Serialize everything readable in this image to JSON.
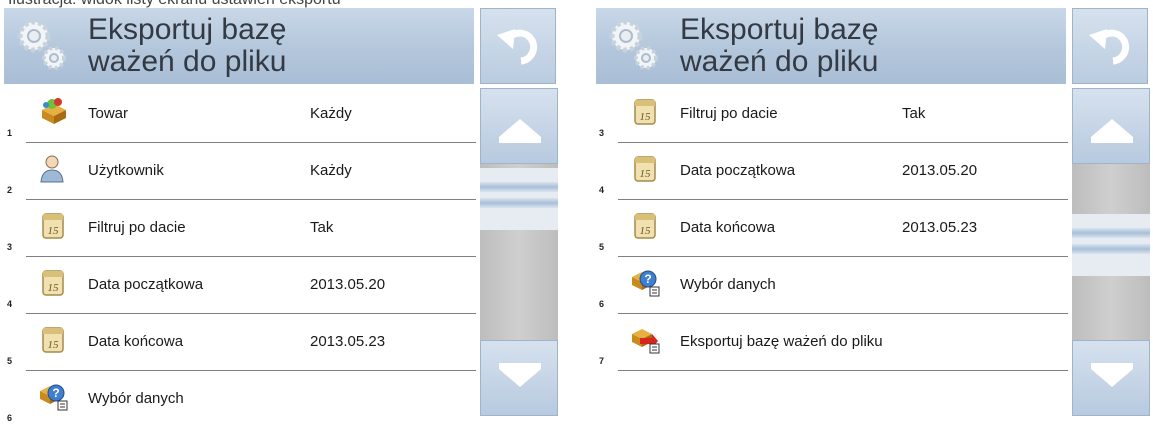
{
  "top_fragment_left": "Ilustracja: widok listy ekranu ustawień eksportu",
  "top_fragment_right": "",
  "panels": [
    {
      "title_line1": "Eksportuj bazę",
      "title_line2": "ważeń do pliku",
      "rows": [
        {
          "num": "1",
          "icon": "product-icon",
          "label": "Towar",
          "value": "Każdy"
        },
        {
          "num": "2",
          "icon": "user-icon",
          "label": "Użytkownik",
          "value": "Każdy"
        },
        {
          "num": "3",
          "icon": "calendar-icon",
          "label": "Filtruj po dacie",
          "value": "Tak"
        },
        {
          "num": "4",
          "icon": "calendar-icon",
          "label": "Data początkowa",
          "value": "2013.05.20"
        },
        {
          "num": "5",
          "icon": "calendar-icon",
          "label": "Data końcowa",
          "value": "2013.05.23"
        },
        {
          "num": "6",
          "icon": "data-select-icon",
          "label": "Wybór danych",
          "value": ""
        }
      ],
      "scroll_position": 0.15
    },
    {
      "title_line1": "Eksportuj bazę",
      "title_line2": "ważeń do pliku",
      "rows": [
        {
          "num": "3",
          "icon": "calendar-icon",
          "label": "Filtruj po dacie",
          "value": "Tak"
        },
        {
          "num": "4",
          "icon": "calendar-icon",
          "label": "Data początkowa",
          "value": "2013.05.20"
        },
        {
          "num": "5",
          "icon": "calendar-icon",
          "label": "Data końcowa",
          "value": "2013.05.23"
        },
        {
          "num": "6",
          "icon": "data-select-icon",
          "label": "Wybór danych",
          "value": ""
        },
        {
          "num": "7",
          "icon": "export-icon",
          "label": "Eksportuj bazę ważeń do pliku",
          "value": ""
        }
      ],
      "scroll_position": 0.7
    }
  ]
}
